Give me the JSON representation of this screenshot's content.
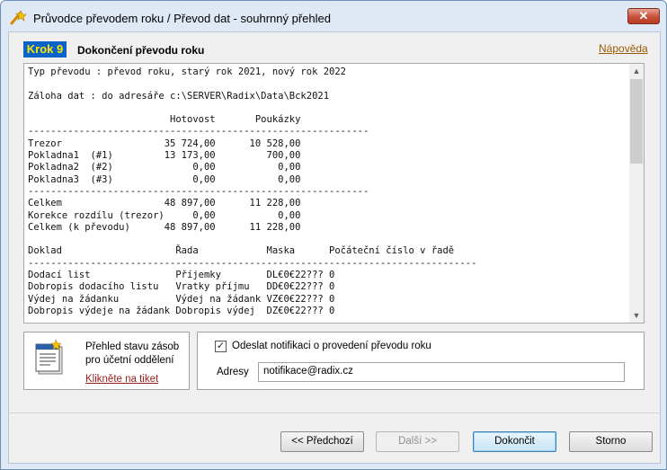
{
  "window": {
    "title": "Průvodce převodem roku / Převod dat - souhrnný přehled",
    "close_glyph": "✕"
  },
  "header": {
    "step_label": "Krok 9",
    "step_title": "Dokončení převodu roku",
    "help_link": "Nápověda"
  },
  "report": {
    "lines": [
      "Typ převodu : převod roku, starý rok 2021, nový rok 2022",
      "",
      "Záloha dat : do adresáře c:\\SERVER\\Radix\\Data\\Bck2021",
      "",
      "                         Hotovost       Poukázky",
      "------------------------------------------------------------",
      "Trezor                  35 724,00      10 528,00",
      "Pokladna1  (#1)         13 173,00         700,00",
      "Pokladna2  (#2)              0,00           0,00",
      "Pokladna3  (#3)              0,00           0,00",
      "------------------------------------------------------------",
      "Celkem                  48 897,00      11 228,00",
      "Korekce rozdílu (trezor)     0,00           0,00",
      "Celkem (k převodu)      48 897,00      11 228,00",
      "",
      "Doklad                    Řada            Maska      Počáteční číslo v řadě",
      "-------------------------------------------------------------------------------",
      "Dodací list               Příjemky        DL€0€22??? 0",
      "Dobropis dodacího listu   Vratky příjmu   DD€0€22??? 0",
      "Výdej na žádanku          Výdej na žádank VZ€0€22??? 0",
      "Dobropis výdeje na žádank Dobropis výdej  DZ€0€22??? 0"
    ]
  },
  "ticket_panel": {
    "line1": "Přehled stavu zásob",
    "line2": "pro účetní oddělení",
    "link": "Klikněte na tiket"
  },
  "notify_panel": {
    "checkbox_label": "Odeslat notifikaci o provedení převodu roku",
    "checked": true,
    "addresses_label": "Adresy",
    "addresses_value": "notifikace@radix.cz"
  },
  "buttons": {
    "prev": "<< Předchozí",
    "next": "Další >>",
    "finish": "Dokončit",
    "cancel": "Storno"
  },
  "colors": {
    "step_badge_bg": "#0b62c9",
    "step_badge_text": "#ffe600",
    "link": "#9a5a00",
    "ticket_link": "#9a2020"
  }
}
